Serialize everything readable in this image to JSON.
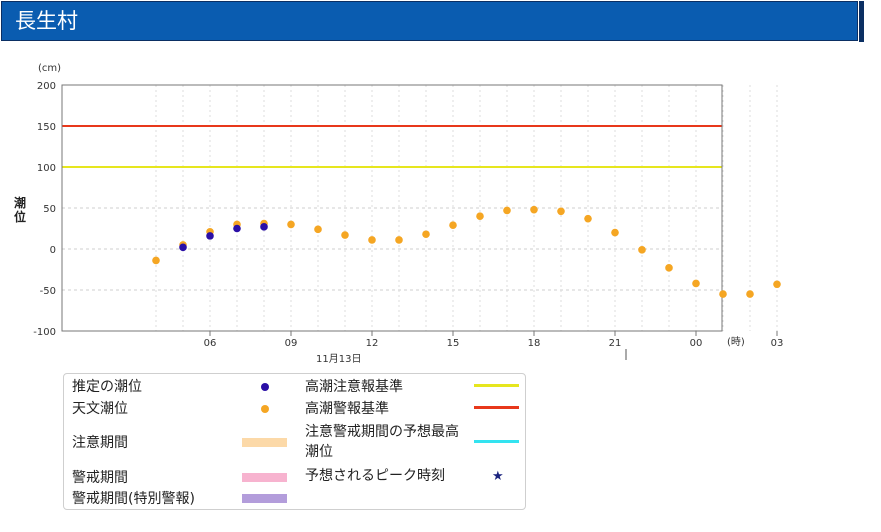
{
  "header": {
    "title": "長生村"
  },
  "chart_data": {
    "type": "scatter",
    "y_unit": "(cm)",
    "ylabel": "潮位",
    "ylim": [
      -100,
      200
    ],
    "y_ticks": [
      "200",
      "150",
      "100",
      "50",
      "0",
      "-50",
      "-100"
    ],
    "x_ticks": [
      "06",
      "09",
      "12",
      "15",
      "18",
      "21",
      "00",
      "03"
    ],
    "x_unit": "(時)",
    "date_label": "11月13日",
    "grid": true,
    "series": [
      {
        "name": "推定の潮位",
        "color": "#2a0fa6",
        "x": [
          "11/13 05:00",
          "11/13 06:00",
          "11/13 07:00",
          "11/13 08:00"
        ],
        "y": [
          2,
          16,
          25,
          27
        ]
      },
      {
        "name": "天文潮位",
        "color": "#f5a623",
        "x": [
          "11/13 04:00",
          "11/13 05:00",
          "11/13 06:00",
          "11/13 07:00",
          "11/13 08:00",
          "11/13 09:00",
          "11/13 10:00",
          "11/13 11:00",
          "11/13 12:00",
          "11/13 13:00",
          "11/13 14:00",
          "11/13 15:00",
          "11/13 16:00",
          "11/13 17:00",
          "11/13 18:00",
          "11/13 19:00",
          "11/13 20:00",
          "11/13 21:00",
          "11/13 22:00",
          "11/13 23:00",
          "11/14 00:00",
          "11/14 01:00",
          "11/14 02:00",
          "11/14 03:00"
        ],
        "y": [
          -14,
          5,
          21,
          30,
          31,
          30,
          24,
          17,
          11,
          11,
          18,
          29,
          40,
          47,
          48,
          46,
          37,
          20,
          -1,
          -23,
          -42,
          -55,
          -55,
          -43
        ]
      }
    ],
    "reference_lines": [
      {
        "name": "高潮注意報基準",
        "value": 100,
        "color": "#e6e61e"
      },
      {
        "name": "高潮警報基準",
        "value": 150,
        "color": "#e8381b"
      }
    ]
  },
  "legend": {
    "items": [
      {
        "label": "推定の潮位",
        "kind": "dot",
        "color": "#2a0fa6"
      },
      {
        "label": "天文潮位",
        "kind": "dot",
        "color": "#f5a623"
      },
      {
        "label": "注意期間",
        "kind": "box",
        "color": "#fcd9a8"
      },
      {
        "label": "警戒期間",
        "kind": "box",
        "color": "#f7b3cf"
      },
      {
        "label": "警戒期間(特別警報)",
        "kind": "box",
        "color": "#b39ddb"
      },
      {
        "label": "高潮注意報基準",
        "kind": "line",
        "color": "#e6e61e"
      },
      {
        "label": "高潮警報基準",
        "kind": "line",
        "color": "#e8381b"
      },
      {
        "label": "注意警戒期間の予想最高潮位",
        "kind": "line",
        "color": "#33e3f0"
      },
      {
        "label": "予想されるピーク時刻",
        "kind": "star",
        "color": "#1a237e"
      }
    ]
  }
}
